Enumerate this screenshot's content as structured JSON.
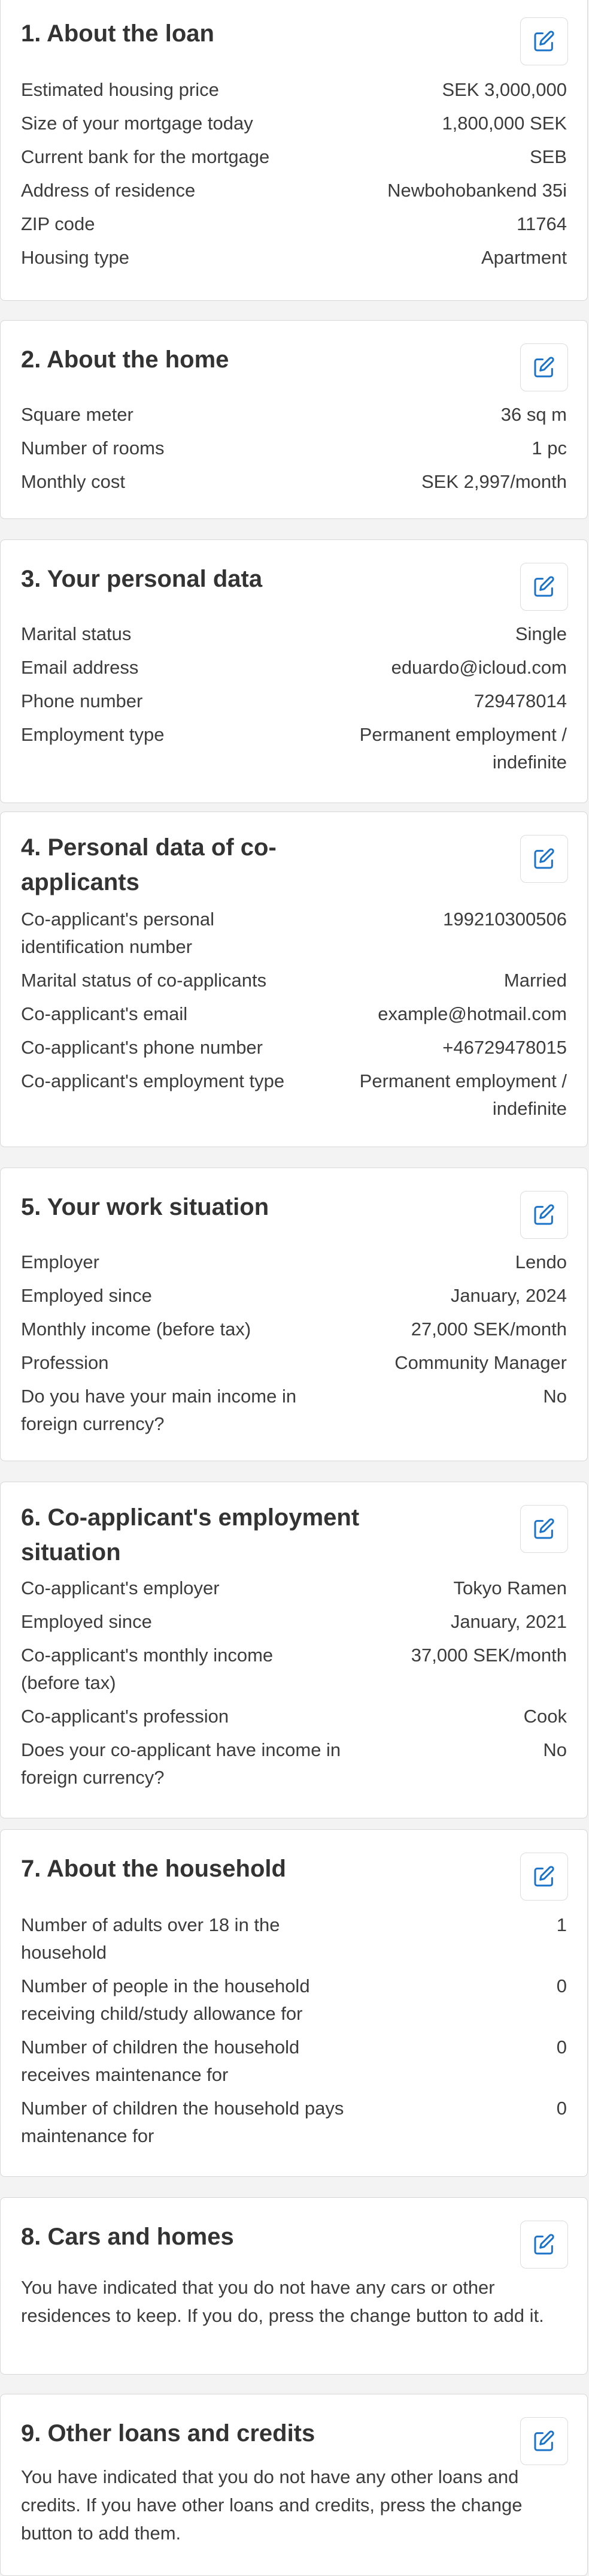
{
  "edit_icon_name": "edit-icon",
  "accent_color": "#1a73c9",
  "sections": [
    {
      "title": "1. About the loan",
      "rows": [
        {
          "label": "Estimated housing price",
          "value": "SEK 3,000,000"
        },
        {
          "label": "Size of your mortgage today",
          "value": "1,800,000 SEK"
        },
        {
          "label": "Current bank for the mortgage",
          "value": "SEB"
        },
        {
          "label": "Address of residence",
          "value": "Newbohobankend 35i"
        },
        {
          "label": "ZIP code",
          "value": "11764"
        },
        {
          "label": "Housing type",
          "value": "Apartment"
        }
      ]
    },
    {
      "title": "2. About the home",
      "rows": [
        {
          "label": "Square meter",
          "value": "36 sq m"
        },
        {
          "label": "Number of rooms",
          "value": "1 pc"
        },
        {
          "label": "Monthly cost",
          "value": "SEK 2,997/month"
        }
      ]
    },
    {
      "title": "3. Your personal data",
      "rows": [
        {
          "label": "Marital status",
          "value": "Single"
        },
        {
          "label": "Email address",
          "value": "eduardo@icloud.com"
        },
        {
          "label": "Phone number",
          "value": "729478014"
        },
        {
          "label": "Employment type",
          "value": "Permanent employment / indefinite"
        }
      ]
    },
    {
      "title": "4. Personal data of co-applicants",
      "rows": [
        {
          "label": "Co-applicant's personal identification number",
          "value": "199210300506"
        },
        {
          "label": "Marital status of co-applicants",
          "value": "Married"
        },
        {
          "label": "Co-applicant's email",
          "value": "example@hotmail.com"
        },
        {
          "label": "Co-applicant's phone number",
          "value": "+46729478015"
        },
        {
          "label": "Co-applicant's employment type",
          "value": "Permanent employment / indefinite"
        }
      ]
    },
    {
      "title": "5. Your work situation",
      "rows": [
        {
          "label": "Employer",
          "value": "Lendo"
        },
        {
          "label": "Employed since",
          "value": "January, 2024"
        },
        {
          "label": "Monthly income (before tax)",
          "value": "27,000 SEK/month"
        },
        {
          "label": "Profession",
          "value": "Community Manager"
        },
        {
          "label": "Do you have your main income in foreign currency?",
          "value": "No"
        }
      ]
    },
    {
      "title": "6. Co-applicant's employment situation",
      "rows": [
        {
          "label": "Co-applicant's employer",
          "value": "Tokyo Ramen"
        },
        {
          "label": "Employed since",
          "value": "January, 2021"
        },
        {
          "label": "Co-applicant's monthly income (before tax)",
          "value": "37,000 SEK/month"
        },
        {
          "label": "Co-applicant's profession",
          "value": "Cook"
        },
        {
          "label": "Does your co-applicant have income in foreign currency?",
          "value": "No"
        }
      ]
    },
    {
      "title": "7. About the household",
      "rows": [
        {
          "label": "Number of adults over 18 in the household",
          "value": "1"
        },
        {
          "label": "Number of people in the household receiving child/study allowance for",
          "value": "0"
        },
        {
          "label": "Number of children the household receives maintenance for",
          "value": "0"
        },
        {
          "label": "Number of children the household pays maintenance for",
          "value": "0"
        }
      ]
    },
    {
      "title": "8. Cars and homes",
      "text": "You have indicated that you do not have any cars or other residences to keep. If you do, press the change button to add it."
    },
    {
      "title": "9. Other loans and credits",
      "text": "You have indicated that you do not have any other loans and credits. If you have other loans and credits, press the change button to add them."
    }
  ]
}
